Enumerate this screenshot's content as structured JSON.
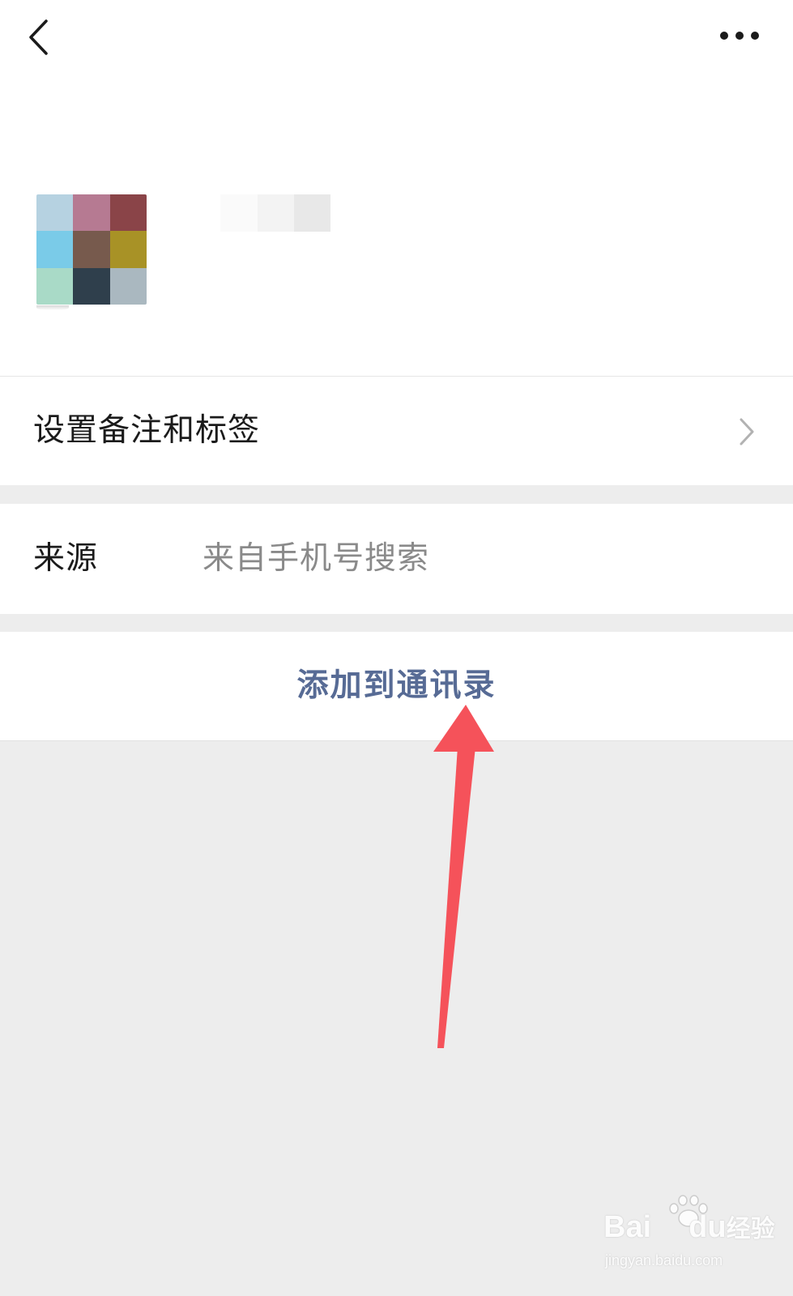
{
  "header": {
    "back_icon": "chevron-left-icon",
    "more_icon": "more-dots-icon"
  },
  "profile": {
    "avatar_colors": [
      "#b6d2e1",
      "#b67a92",
      "#8a4448",
      "#7acbe8",
      "#775a4d",
      "#a89226",
      "#a9dac7",
      "#2f3f4c",
      "#aab8c0"
    ],
    "name_blur_colors": [
      "#fafafa",
      "#f3f3f3",
      "#e8e8e8"
    ]
  },
  "rows": {
    "remark": {
      "label": "设置备注和标签",
      "chevron_icon": "chevron-right-icon"
    },
    "source": {
      "label": "来源",
      "value": "来自手机号搜索"
    },
    "add_contact": {
      "label": "添加到通讯录"
    }
  },
  "annotation": {
    "arrow_color": "#f5525a"
  },
  "watermark": {
    "brand": "Bai",
    "brand2": "du",
    "brand3": "经验",
    "url": "jingyan.baidu.com"
  },
  "colors": {
    "link_blue": "#576b95",
    "background": "#ededed"
  }
}
